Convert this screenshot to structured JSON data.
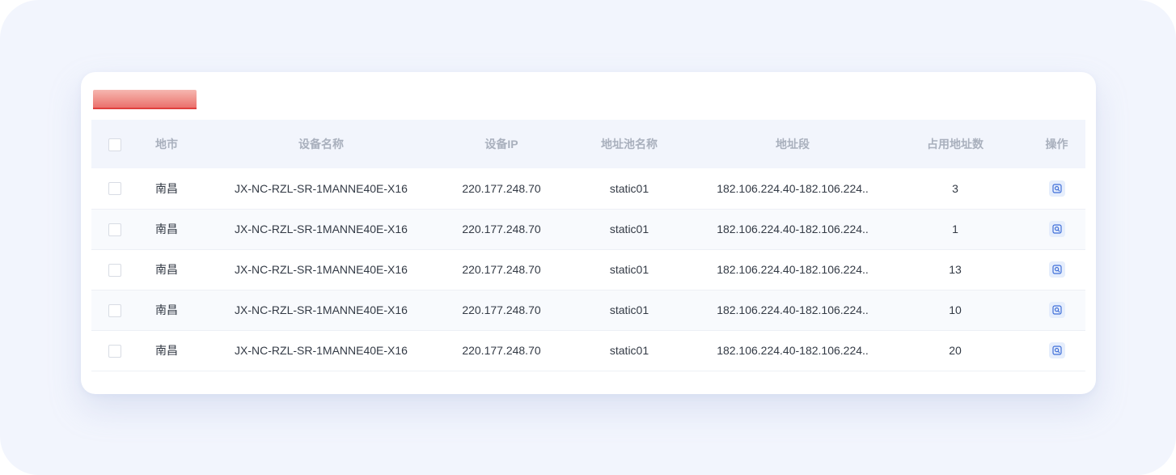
{
  "table": {
    "columns": [
      "地市",
      "设备名称",
      "设备IP",
      "地址池名称",
      "地址段",
      "占用地址数",
      "操作"
    ],
    "rows": [
      {
        "city": "南昌",
        "device_name": "JX-NC-RZL-SR-1MANNE40E-X16",
        "device_ip": "220.177.248.70",
        "pool_name": "static01",
        "segment": "182.106.224.40-182.106.224..",
        "used_count": "3"
      },
      {
        "city": "南昌",
        "device_name": "JX-NC-RZL-SR-1MANNE40E-X16",
        "device_ip": "220.177.248.70",
        "pool_name": "static01",
        "segment": "182.106.224.40-182.106.224..",
        "used_count": "1"
      },
      {
        "city": "南昌",
        "device_name": "JX-NC-RZL-SR-1MANNE40E-X16",
        "device_ip": "220.177.248.70",
        "pool_name": "static01",
        "segment": "182.106.224.40-182.106.224..",
        "used_count": "13"
      },
      {
        "city": "南昌",
        "device_name": "JX-NC-RZL-SR-1MANNE40E-X16",
        "device_ip": "220.177.248.70",
        "pool_name": "static01",
        "segment": "182.106.224.40-182.106.224..",
        "used_count": "10"
      },
      {
        "city": "南昌",
        "device_name": "JX-NC-RZL-SR-1MANNE40E-X16",
        "device_ip": "220.177.248.70",
        "pool_name": "static01",
        "segment": "182.106.224.40-182.106.224..",
        "used_count": "20"
      }
    ],
    "action_icon": "view-detail-icon"
  },
  "colors": {
    "page_bg": "#f2f5fd",
    "header_bg": "#f2f5fc",
    "header_text": "#a9b0bd",
    "body_text": "#333a45",
    "action_icon": "#3f6fd8",
    "banner_accent": "#e0403e"
  }
}
